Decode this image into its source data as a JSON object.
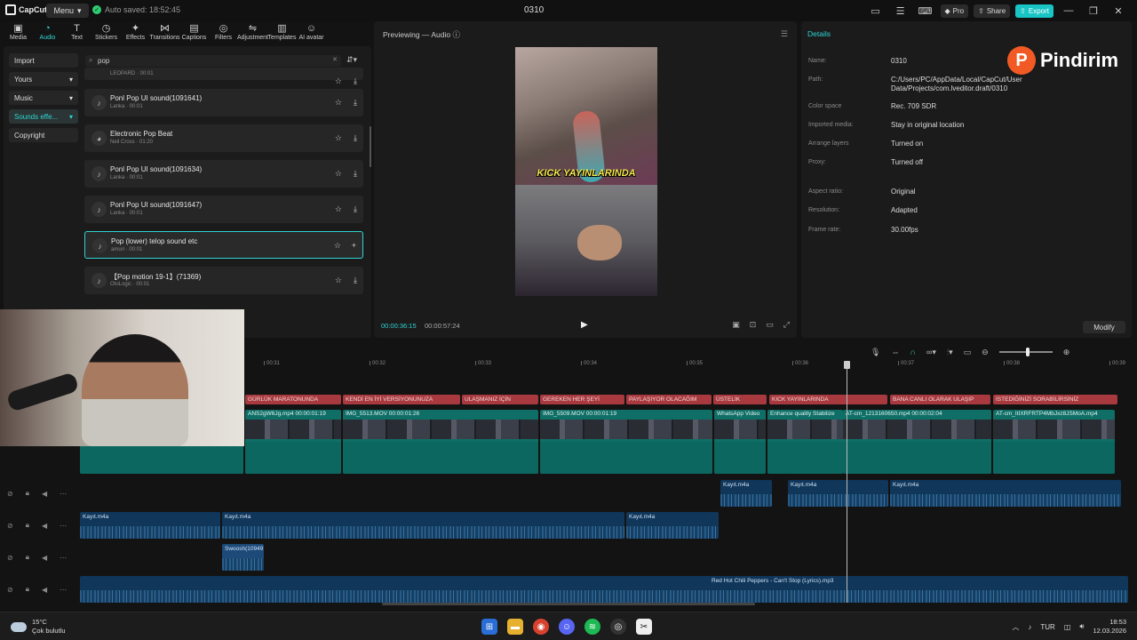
{
  "titlebar": {
    "app_name": "CapCut",
    "menu_label": "Menu",
    "autosave_text": "Auto saved: 18:52:45",
    "project_title": "0310",
    "pro_label": "Pro",
    "share_label": "Share",
    "export_label": "Export"
  },
  "toolbar": {
    "tabs": [
      {
        "label": "Media",
        "icon": "media-icon",
        "glyph": "▣"
      },
      {
        "label": "Audio",
        "icon": "audio-icon",
        "glyph": "◔"
      },
      {
        "label": "Text",
        "icon": "text-icon",
        "glyph": "T"
      },
      {
        "label": "Stickers",
        "icon": "stickers-icon",
        "glyph": "◷"
      },
      {
        "label": "Effects",
        "icon": "effects-icon",
        "glyph": "✦"
      },
      {
        "label": "Transitions",
        "icon": "transitions-icon",
        "glyph": "⋈"
      },
      {
        "label": "Captions",
        "icon": "captions-icon",
        "glyph": "▤"
      },
      {
        "label": "Filters",
        "icon": "filters-icon",
        "glyph": "◎"
      },
      {
        "label": "Adjustment",
        "icon": "adjustment-icon",
        "glyph": "⇋"
      },
      {
        "label": "Templates",
        "icon": "templates-icon",
        "glyph": "▥"
      },
      {
        "label": "AI avatar",
        "icon": "ai-avatar-icon",
        "glyph": "☺"
      }
    ],
    "active_tab": "Audio"
  },
  "audio_panel": {
    "categories": [
      "Import",
      "Yours",
      "Music",
      "Sounds effe...",
      "Copyright"
    ],
    "active_category": "Sounds effe...",
    "search_value": "pop",
    "sounds": [
      {
        "name": "",
        "meta": "LEOPARD · 00:01",
        "partial": true
      },
      {
        "name": "Ponl Pop UI sound(1091641)",
        "meta": "Lanka · 00:01"
      },
      {
        "name": "Electronic Pop Beat",
        "meta": "Neil Cross · 01:20"
      },
      {
        "name": "Ponl Pop UI sound(1091634)",
        "meta": "Lanka · 00:01"
      },
      {
        "name": "Ponl Pop UI sound(1091647)",
        "meta": "Lanka · 00:01"
      },
      {
        "name": "Pop (lower) telop sound etc",
        "meta": "amuri · 00:01",
        "active": true
      },
      {
        "name": "【Pop motion 19-1】(71369)",
        "meta": "OtoLogic · 00:01"
      }
    ]
  },
  "preview": {
    "title": "Previewing — Audio",
    "caption_text": "KICK YAYINLARINDA",
    "current_time": "00:00:36:15",
    "total_time": "00:00:57:24"
  },
  "details": {
    "title": "Details",
    "rows": [
      {
        "label": "Name:",
        "value": "0310"
      },
      {
        "label": "Path:",
        "value": "C:/Users/PC/AppData/Local/CapCut/User Data/Projects/com.lveditor.draft/0310"
      },
      {
        "label": "Color space",
        "value": "Rec. 709 SDR"
      },
      {
        "label": "Imported media:",
        "value": "Stay in original location"
      },
      {
        "label": "Arrange layers",
        "value": "Turned on"
      },
      {
        "label": "Proxy:",
        "value": "Turned off"
      },
      {
        "label": "Aspect ratio:",
        "value": "Original"
      },
      {
        "label": "Resolution:",
        "value": "Adapted"
      },
      {
        "label": "Frame rate:",
        "value": "30.00fps"
      }
    ],
    "modify_label": "Modify"
  },
  "watermark": {
    "letter": "P",
    "text": "Pindirim"
  },
  "timeline": {
    "ruler_ticks": [
      "00:31",
      "00:32",
      "00:33",
      "00:34",
      "00:35",
      "00:36",
      "00:37",
      "00:38",
      "00:39"
    ],
    "text_clips": [
      "GÜRLÜK MARATONUNDA",
      "KENDİ EN İYİ VERSİYONUNUZA",
      "ULAŞMANIZ İÇİN",
      "GEREKEN HER ŞEYİ",
      "PAYLAŞIYOR OLACAĞIM",
      "ÜSTELİK",
      "KICK YAYINLARINDA",
      "BANA CANLI OLARAK ULAŞIP",
      "İSTEDİĞİNİZİ SORABİLİRSİNİZ"
    ],
    "video_clips": [
      "ANS2gW6Jg.mp4   00:00:01:19",
      "IMG_5513.MOV   00:00:01:26",
      "IMG_5509.MOV   00:00:01:19",
      "WhatsApp Video",
      "Enhance quality   Stabilize",
      "AT-cm_1213160650.mp4   00:00:02:04",
      "AT-cm_ItIXRFRTP4MbJxz8JSMoA.mp4"
    ],
    "audio_clips": {
      "track1": [
        "Kayıt.m4a",
        "Kayıt.m4a",
        "Kayıt.m4a"
      ],
      "track2": [
        "Kayıt.m4a",
        "Kayıt.m4a",
        "Kayıt.m4a"
      ],
      "track3": [
        "Swoosh(10949"
      ],
      "track4": [
        "Red Hot Chili Peppers - Can't Stop (Lyrics).mp3"
      ]
    }
  },
  "taskbar": {
    "temperature": "15°C",
    "weather": "Çok bulutlu",
    "language": "TUR",
    "time": "18:53",
    "date": "12.03.2026"
  }
}
